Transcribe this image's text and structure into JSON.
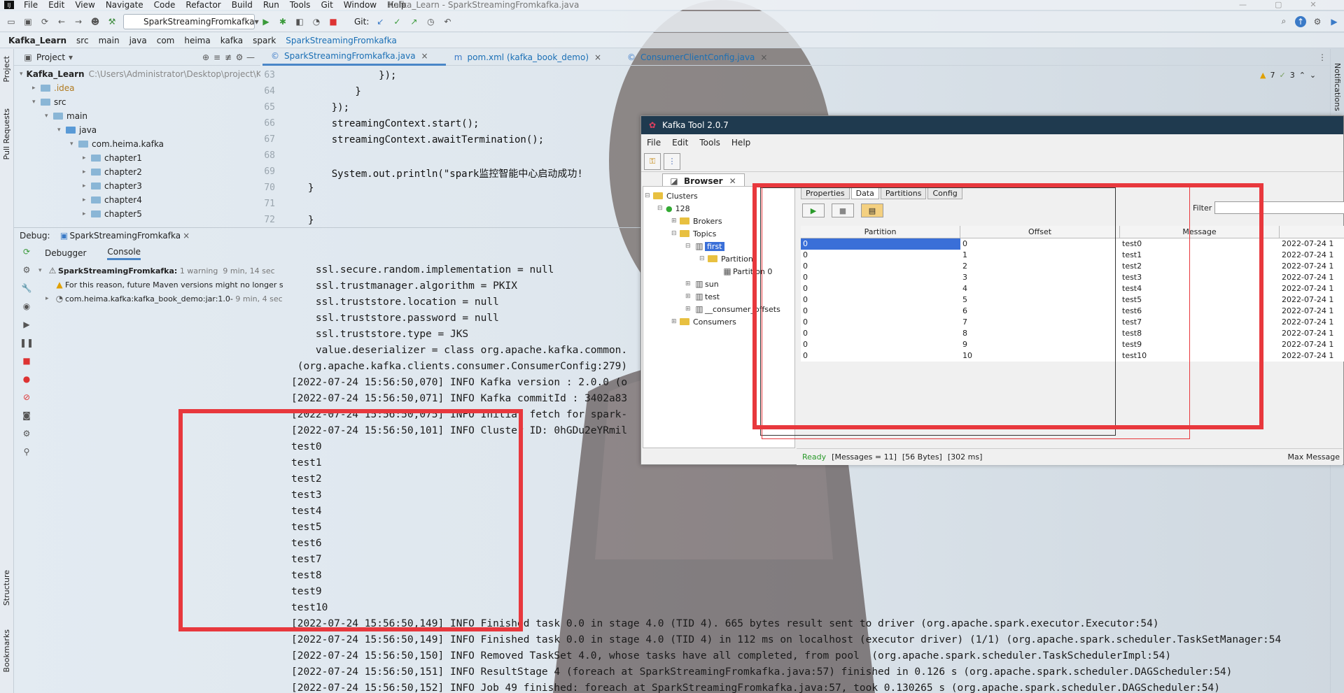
{
  "window_title": "Kafka_Learn - SparkStreamingFromkafka.java",
  "menu": [
    "File",
    "Edit",
    "View",
    "Navigate",
    "Code",
    "Refactor",
    "Build",
    "Run",
    "Tools",
    "Git",
    "Window",
    "Help"
  ],
  "toolbar": {
    "run_config": "SparkStreamingFromkafka",
    "git_label": "Git:"
  },
  "breadcrumb": [
    "Kafka_Learn",
    "src",
    "main",
    "java",
    "com",
    "heima",
    "kafka",
    "spark",
    "SparkStreamingFromkafka"
  ],
  "left_strip": {
    "project": "Project",
    "pull_requests": "Pull Requests",
    "structure": "Structure",
    "bookmarks": "Bookmarks"
  },
  "right_strip": {
    "notifications": "Notifications"
  },
  "project": {
    "title": "Project",
    "root_name": "Kafka_Learn",
    "root_path": "C:\\Users\\Administrator\\Desktop\\project\\Ka",
    "nodes": [
      ".idea",
      "src",
      "main",
      "java",
      "com.heima.kafka",
      "chapter1",
      "chapter2",
      "chapter3",
      "chapter4",
      "chapter5"
    ]
  },
  "editor_tabs": [
    "SparkStreamingFromkafka.java",
    "pom.xml (kafka_book_demo)",
    "ConsumerClientConfig.java"
  ],
  "inspections": {
    "warnings": "7",
    "weak": "3"
  },
  "code_lines": [
    {
      "n": "63",
      "t": "            });"
    },
    {
      "n": "64",
      "t": "        }"
    },
    {
      "n": "65",
      "t": "    });"
    },
    {
      "n": "66",
      "t": "    streamingContext.start();"
    },
    {
      "n": "67",
      "t": "    streamingContext.awaitTermination();"
    },
    {
      "n": "68",
      "t": ""
    },
    {
      "n": "69",
      "t": "    System.out.println(\"spark监控智能中心启动成功!"
    },
    {
      "n": "70",
      "t": "}"
    },
    {
      "n": "71",
      "t": ""
    },
    {
      "n": "72",
      "t": "}"
    }
  ],
  "debug": {
    "label": "Debug:",
    "config": "SparkStreamingFromkafka",
    "tabs": [
      "Debugger",
      "Console"
    ],
    "tree": [
      {
        "name": "SparkStreamingFromkafka:",
        "meta": "1 warning",
        "time": "9 min, 14 sec"
      },
      {
        "name": "For this reason, future Maven versions might no longer s",
        "meta": "",
        "time": ""
      },
      {
        "name": "com.heima.kafka:kafka_book_demo:jar:1.0-",
        "meta": "",
        "time": "9 min, 4 sec"
      }
    ]
  },
  "console_lines": [
    "    ssl.secure.random.implementation = null",
    "    ssl.trustmanager.algorithm = PKIX",
    "    ssl.truststore.location = null",
    "    ssl.truststore.password = null",
    "    ssl.truststore.type = JKS",
    "    value.deserializer = class org.apache.kafka.common.",
    " (org.apache.kafka.clients.consumer.ConsumerConfig:279)",
    "[2022-07-24 15:56:50,070] INFO Kafka version : 2.0.0 (o",
    "[2022-07-24 15:56:50,071] INFO Kafka commitId : 3402a83",
    "[2022-07-24 15:56:50,075] INFO Initial fetch for spark-",
    "[2022-07-24 15:56:50,101] INFO Cluster ID: 0hGDu2eYRmil",
    "test0",
    "test1",
    "test2",
    "test3",
    "test4",
    "test5",
    "test6",
    "test7",
    "test8",
    "test9",
    "test10",
    "[2022-07-24 15:56:50,149] INFO Finished task 0.0 in stage 4.0 (TID 4). 665 bytes result sent to driver (org.apache.spark.executor.Executor:54)",
    "[2022-07-24 15:56:50,149] INFO Finished task 0.0 in stage 4.0 (TID 4) in 112 ms on localhost (executor driver) (1/1) (org.apache.spark.scheduler.TaskSetManager:54",
    "[2022-07-24 15:56:50,150] INFO Removed TaskSet 4.0, whose tasks have all completed, from pool  (org.apache.spark.scheduler.TaskSchedulerImpl:54)",
    "[2022-07-24 15:56:50,151] INFO ResultStage 4 (foreach at SparkStreamingFromkafka.java:57) finished in 0.126 s (org.apache.spark.scheduler.DAGScheduler:54)",
    "[2022-07-24 15:56:50,152] INFO Job 49 finished: foreach at SparkStreamingFromkafka.java:57, took 0.130265 s (org.apache.spark.scheduler.DAGScheduler:54)"
  ],
  "kafka_tool": {
    "title": "Kafka Tool  2.0.7",
    "menu": [
      "File",
      "Edit",
      "Tools",
      "Help"
    ],
    "browser_tab": "Browser",
    "tree": {
      "clusters": "Clusters",
      "cluster": "128",
      "brokers": "Brokers",
      "topics": "Topics",
      "topic_selected": "first",
      "partitions": "Partitions",
      "partition": "Partition 0",
      "others": [
        "sun",
        "test",
        "__consumer_offsets"
      ],
      "consumers": "Consumers"
    },
    "detail_tabs": [
      "Properties",
      "Data",
      "Partitions",
      "Config"
    ],
    "filter_label": "Filter",
    "columns": [
      "Partition",
      "Offset",
      "Message",
      ""
    ],
    "rows": [
      {
        "p": "0",
        "o": "0",
        "m": "test0",
        "t": "2022-07-24 1"
      },
      {
        "p": "0",
        "o": "1",
        "m": "test1",
        "t": "2022-07-24 1"
      },
      {
        "p": "0",
        "o": "2",
        "m": "test2",
        "t": "2022-07-24 1"
      },
      {
        "p": "0",
        "o": "3",
        "m": "test3",
        "t": "2022-07-24 1"
      },
      {
        "p": "0",
        "o": "4",
        "m": "test4",
        "t": "2022-07-24 1"
      },
      {
        "p": "0",
        "o": "5",
        "m": "test5",
        "t": "2022-07-24 1"
      },
      {
        "p": "0",
        "o": "6",
        "m": "test6",
        "t": "2022-07-24 1"
      },
      {
        "p": "0",
        "o": "7",
        "m": "test7",
        "t": "2022-07-24 1"
      },
      {
        "p": "0",
        "o": "8",
        "m": "test8",
        "t": "2022-07-24 1"
      },
      {
        "p": "0",
        "o": "9",
        "m": "test9",
        "t": "2022-07-24 1"
      },
      {
        "p": "0",
        "o": "10",
        "m": "test10",
        "t": "2022-07-24 1"
      }
    ],
    "status": {
      "ready": "Ready",
      "messages": "[Messages = 11]",
      "bytes": "[56 Bytes]",
      "ms": "[302 ms]",
      "max": "Max Message"
    }
  },
  "colors": {
    "annotation_red": "#e8383d",
    "accent_blue": "#4a86c7",
    "kafka_titlebar": "#1f3a4f"
  }
}
